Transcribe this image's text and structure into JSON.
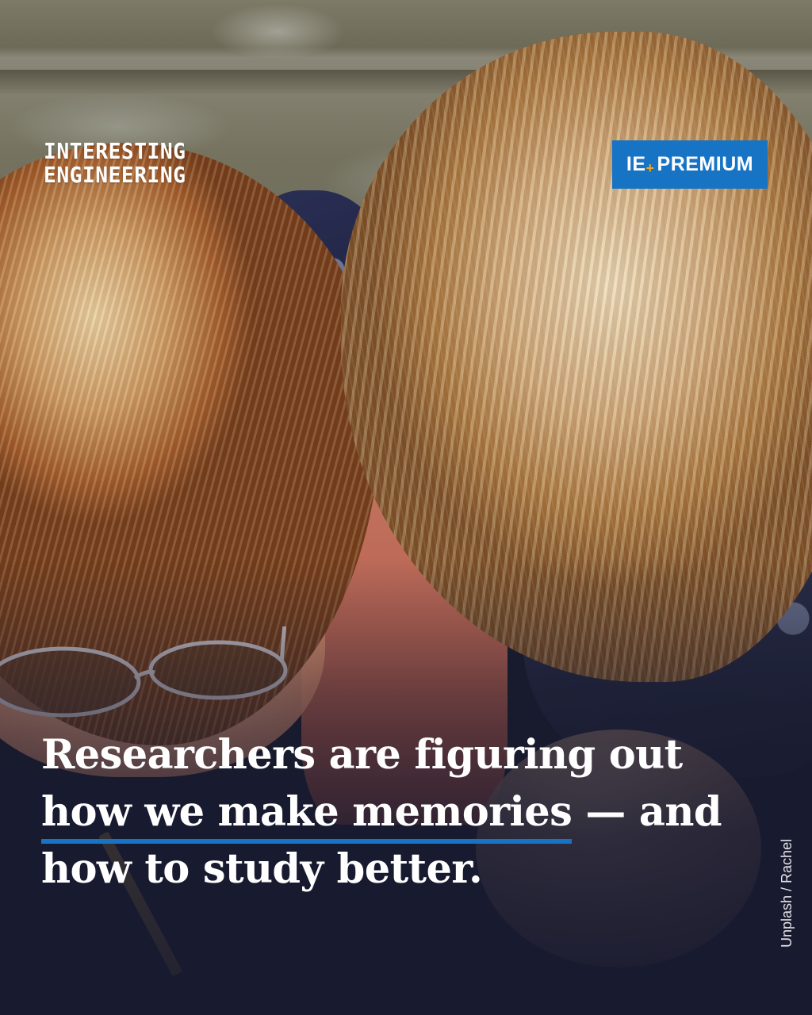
{
  "brand": {
    "logo_line1": "INTERESTING",
    "logo_line2": "ENGINEERING"
  },
  "badge": {
    "ie_label": "IE",
    "plus_symbol": "+",
    "premium_label": "PREMIUM",
    "color": "#1774c4",
    "plus_color": "#f2a51e"
  },
  "headline": {
    "line1": "Researchers are figuring out",
    "line2_highlight": "how we make memories",
    "line2_rest": " — and",
    "line3": "how to study better.",
    "underline_color": "#1774c4"
  },
  "credit": {
    "text": "Unplash / Rachel"
  }
}
